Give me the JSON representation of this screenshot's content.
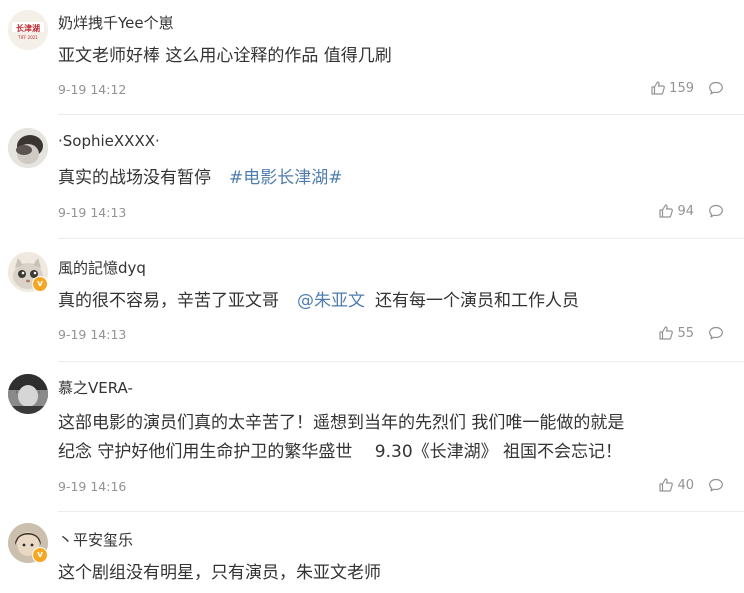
{
  "comments": [
    {
      "username": "奶烊拽千Yee个崽",
      "text": "亚文老师好棒 这么用心诠释的作品 值得几刷",
      "time": "9-19 14:12",
      "likes": "159"
    },
    {
      "username": "·SophieXXXX·",
      "text": "真实的战场没有暂停",
      "hashtag": "#电影长津湖#",
      "time": "9-19 14:13",
      "likes": "94"
    },
    {
      "username": "風的記憶dyq",
      "text_before": "真的很不容易，辛苦了亚文哥",
      "mention": "@朱亚文",
      "text_after": "还有每一个演员和工作人员",
      "time": "9-19 14:13",
      "likes": "55"
    },
    {
      "username": "慕之VERA-",
      "text_line1": "这部电影的演员们真的太辛苦了！遥想到当年的先烈们 我们唯一能做的就是",
      "text_line2": "纪念 守护好他们用生命护卫的繁华盛世　 9.30《长津湖》 祖国不会忘记！",
      "time": "9-19 14:16",
      "likes": "40"
    },
    {
      "username": "丶平安玺乐",
      "text": "这个剧组没有明星，只有演员，朱亚文老师"
    }
  ],
  "avatar_logo_text": "长津湖",
  "avatar_logo_subtext": "TIFF 2021",
  "badge_mark": "v",
  "colors": {
    "link": "#507daf",
    "meta": "#939393",
    "text": "#333333",
    "badge": "#f5a623",
    "divider": "#ececec"
  },
  "icons": [
    "thumbs-up-icon",
    "comment-bubble-icon",
    "verified-badge-icon"
  ]
}
